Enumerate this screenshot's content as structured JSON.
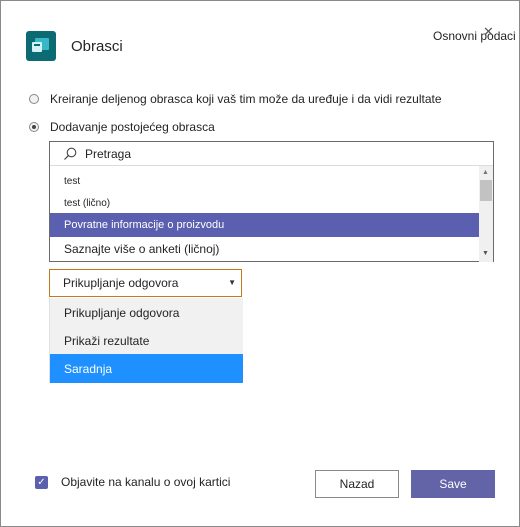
{
  "header": {
    "app_title": "Obrasci",
    "settings_link": "Osnovni podaci",
    "close_glyph": "✕",
    "app_icon": "forms-icon"
  },
  "options": {
    "create_shared": "Kreiranje deljenog obrasca koji vaš tim može da uređuje i da vidi rezultate",
    "add_existing": "Dodavanje postojećeg obrasca",
    "selected": "add_existing"
  },
  "search": {
    "value": "Pretraga"
  },
  "forms_list": {
    "items": [
      {
        "label": "test"
      },
      {
        "label": "test (lično)"
      },
      {
        "label": "Povratne informacije o proizvodu",
        "selected": true
      },
      {
        "label": "Saznajte više o anketi (ličnoj)"
      }
    ]
  },
  "mode_select": {
    "value": "Prikupljanje odgovora",
    "options": [
      "Prikupljanje odgovora",
      "Prikaži rezultate",
      "Saradnja"
    ],
    "highlighted": "Saradnja"
  },
  "footer": {
    "post_checkbox_label": "Objavite na kanalu o ovoj kartici",
    "post_checked": true,
    "back_label": "Nazad",
    "save_label": "Save"
  },
  "colors": {
    "accent": "#6264a7",
    "selected_item": "#5b5fb0",
    "highlight_option": "#1e90ff",
    "select_border": "#c47a18"
  }
}
